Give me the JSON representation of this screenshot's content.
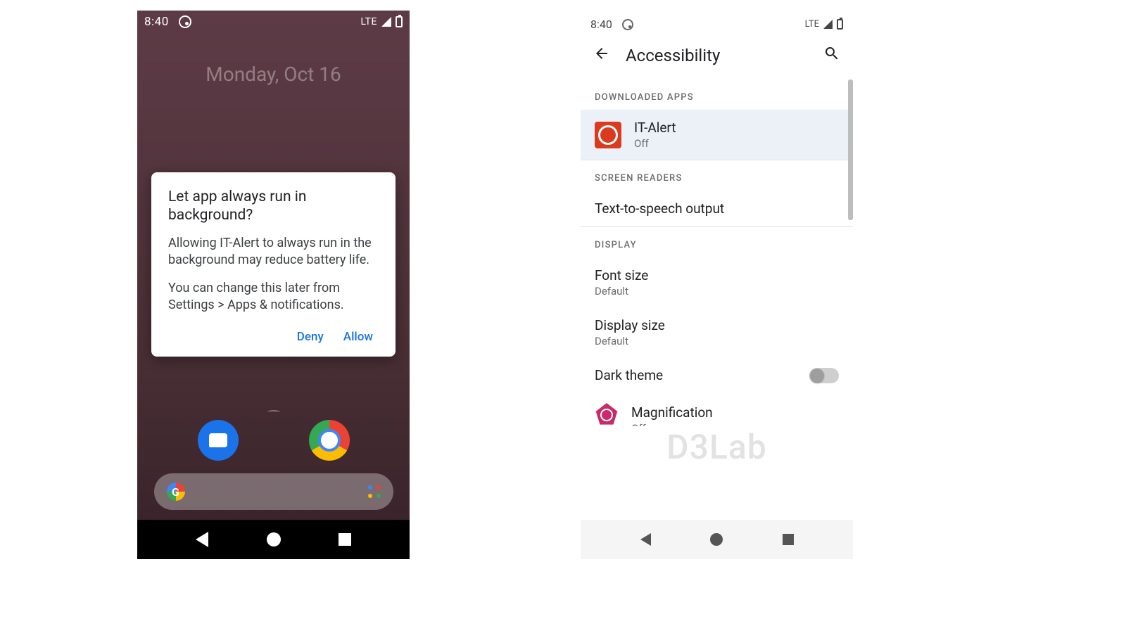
{
  "phone1": {
    "status": {
      "time": "8:40",
      "net": "LTE"
    },
    "date": "Monday, Oct 16",
    "dialog": {
      "title": "Let app always run in background?",
      "body1": "Allowing IT-Alert to always run in the background may reduce battery life.",
      "body2": "You can change this later from Settings > Apps & notifications.",
      "deny": "Deny",
      "allow": "Allow"
    }
  },
  "phone2": {
    "status": {
      "time": "8:40",
      "net": "LTE"
    },
    "appbar": {
      "title": "Accessibility"
    },
    "sections": {
      "downloaded": "DOWNLOADED APPS",
      "screenReaders": "SCREEN READERS",
      "display": "DISPLAY"
    },
    "items": {
      "itAlert": {
        "title": "IT-Alert",
        "sub": "Off"
      },
      "tts": {
        "title": "Text-to-speech output"
      },
      "fontSize": {
        "title": "Font size",
        "sub": "Default"
      },
      "displaySize": {
        "title": "Display size",
        "sub": "Default"
      },
      "darkTheme": {
        "title": "Dark theme"
      },
      "magnification": {
        "title": "Magnification",
        "sub": "Off"
      }
    },
    "watermark": "D3Lab"
  }
}
